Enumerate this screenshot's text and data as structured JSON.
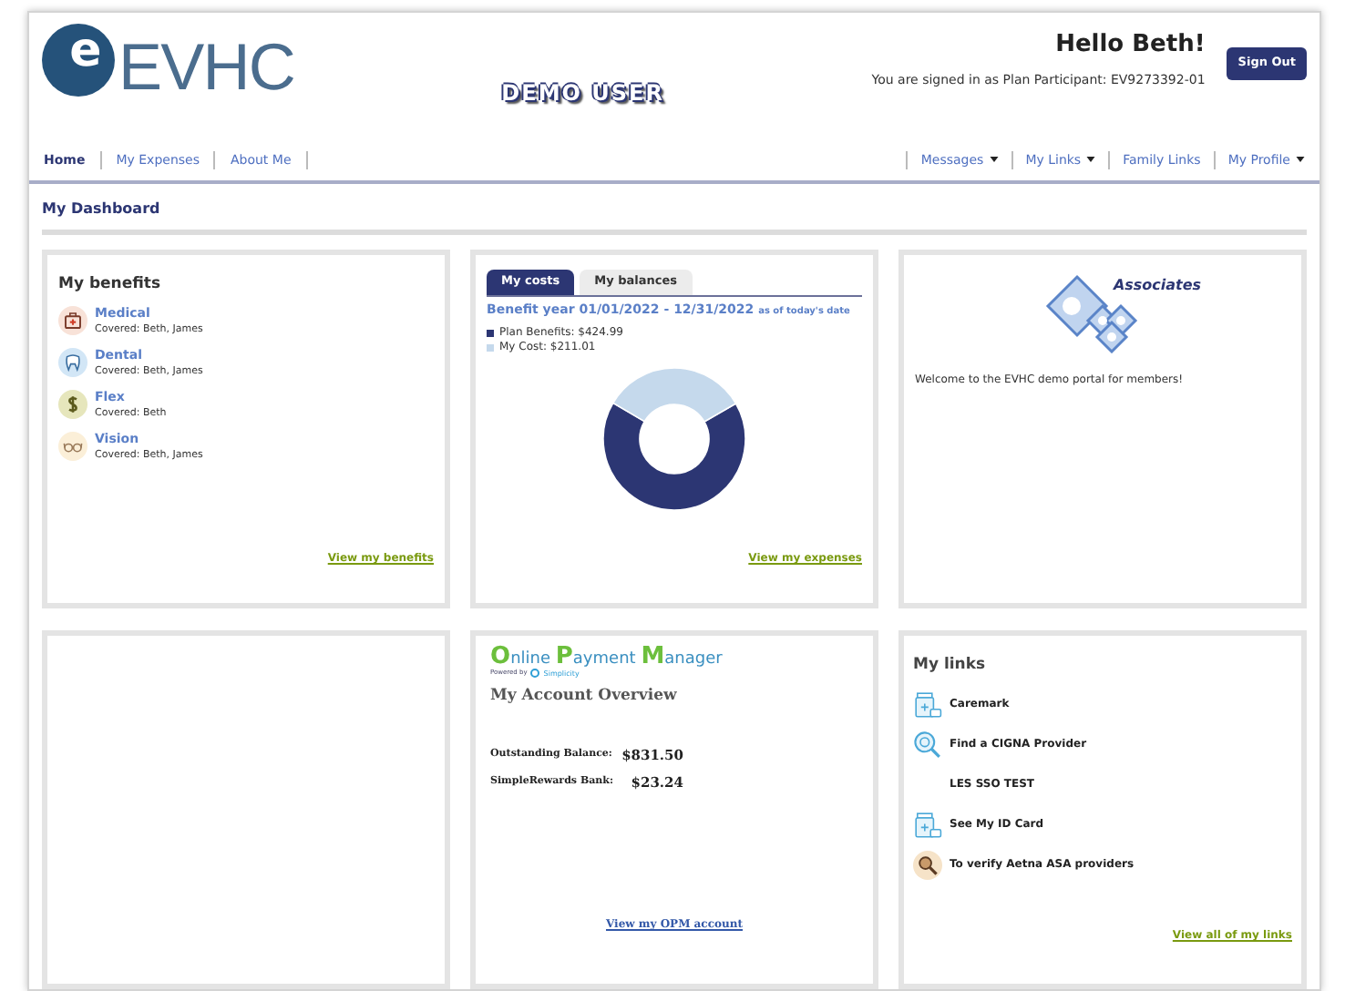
{
  "header": {
    "logo": {
      "mark": "e",
      "text": "EVHC"
    },
    "demo_label": "DEMO USER",
    "greeting": "Hello Beth!",
    "signed_in": "You are signed in as Plan Participant: EV9273392-01",
    "sign_out": "Sign Out"
  },
  "nav": {
    "left": [
      {
        "label": "Home",
        "selected": true
      },
      {
        "label": "My Expenses",
        "selected": false
      },
      {
        "label": "About Me",
        "selected": false
      }
    ],
    "right": [
      {
        "label": "Messages",
        "dropdown": true
      },
      {
        "label": "My Links",
        "dropdown": true
      },
      {
        "label": "Family Links",
        "dropdown": false
      },
      {
        "label": "My Profile",
        "dropdown": true
      }
    ]
  },
  "page_title": "My Dashboard",
  "benefits": {
    "title": "My benefits",
    "items": [
      {
        "kind": "medical",
        "name": "Medical",
        "covered": "Covered: Beth, James"
      },
      {
        "kind": "dental",
        "name": "Dental",
        "covered": "Covered: Beth, James"
      },
      {
        "kind": "flex",
        "name": "Flex",
        "covered": "Covered: Beth"
      },
      {
        "kind": "vision",
        "name": "Vision",
        "covered": "Covered: Beth, James"
      }
    ],
    "link": "View my benefits"
  },
  "costs": {
    "tabs": [
      {
        "label": "My costs",
        "selected": true
      },
      {
        "label": "My balances",
        "selected": false
      }
    ],
    "period": "Benefit year 01/01/2022 - 12/31/2022",
    "period_note": "as of today's date",
    "legend": [
      {
        "text": "Plan Benefits: $424.99",
        "color": "#2c3673"
      },
      {
        "text": "My Cost: $211.01",
        "color": "#c5d9ec"
      }
    ],
    "chart_data": {
      "type": "donut",
      "values": [
        66.82,
        33.18
      ]
    },
    "link": "View my expenses"
  },
  "welcome": {
    "logo_text": "Associates",
    "message": "Welcome to the EVHC demo portal for members!"
  },
  "opm": {
    "logo_words": [
      "Online",
      "Payment",
      "Manager"
    ],
    "powered_by": "Powered by",
    "powered_brand": "Simplicity",
    "title": "My Account Overview",
    "rows": [
      {
        "label": "Outstanding Balance:",
        "value": "$831.50"
      },
      {
        "label": "SimpleRewards Bank:",
        "value": "$23.24"
      }
    ],
    "link": "View my OPM account"
  },
  "links": {
    "title": "My links",
    "items": [
      {
        "kind": "card",
        "label": "Caremark"
      },
      {
        "kind": "search",
        "label": "Find a CIGNA Provider"
      },
      {
        "kind": "none",
        "label": "LES SSO TEST"
      },
      {
        "kind": "card",
        "label": "See My ID Card"
      },
      {
        "kind": "search_dark",
        "label": "To verify Aetna ASA providers"
      }
    ],
    "link": "View all of my links"
  }
}
